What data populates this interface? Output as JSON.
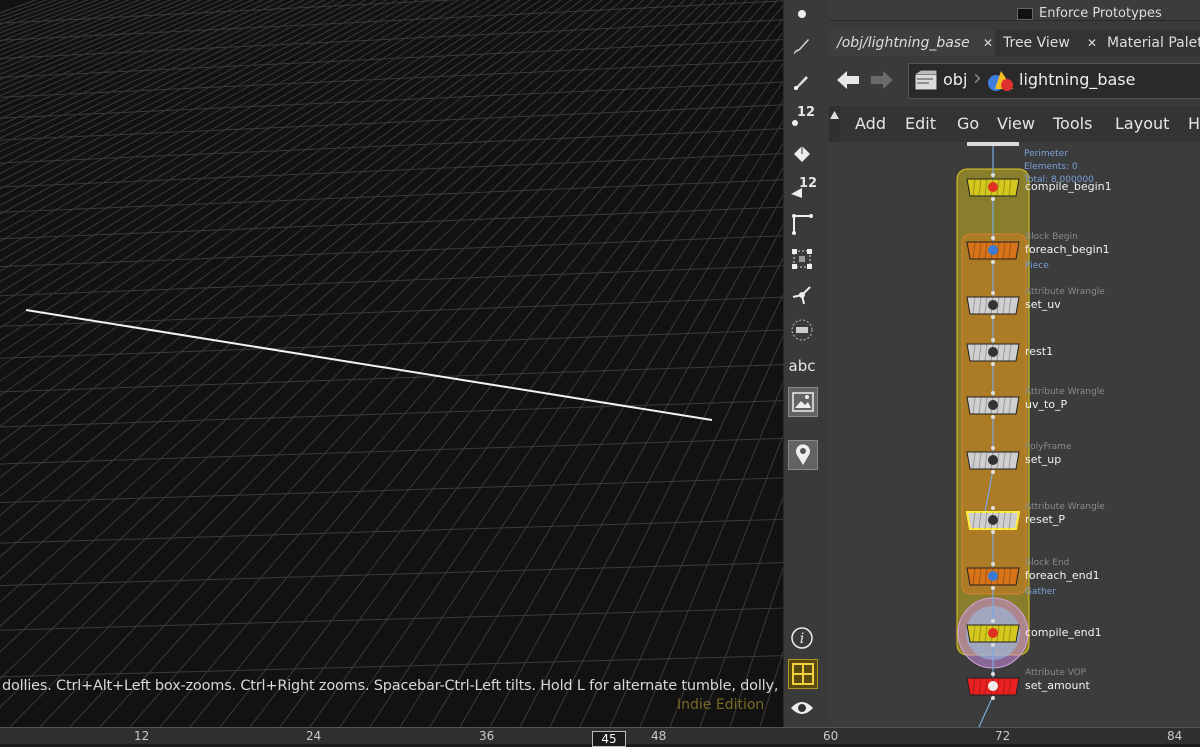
{
  "viewport": {
    "hint_text": "dollies. Ctrl+Alt+Left box-zooms. Ctrl+Right zooms. Spacebar-Ctrl-Left tilts. Hold L for alternate tumble, dolly,",
    "edition_label": "Indie Edition"
  },
  "toolbar": {
    "items": [
      {
        "name": "select-icon"
      },
      {
        "name": "brush-icon"
      },
      {
        "name": "pen-icon"
      },
      {
        "name": "snap-12-icon",
        "label": "12"
      },
      {
        "name": "paint-bucket-icon"
      },
      {
        "name": "display-12-icon",
        "label": "12"
      },
      {
        "name": "angle-icon"
      },
      {
        "name": "bounding-box-icon"
      },
      {
        "name": "transform-handle-icon"
      },
      {
        "name": "ghost-icon"
      },
      {
        "name": "text-abc-icon",
        "label": "abc"
      },
      {
        "name": "background-image-icon"
      },
      {
        "name": "pin-icon"
      },
      {
        "name": "info-icon"
      },
      {
        "name": "grid-view-icon"
      },
      {
        "name": "eye-icon"
      }
    ]
  },
  "timeline": {
    "ticks": [
      "12",
      "24",
      "36",
      "48",
      "60",
      "72",
      "84"
    ],
    "current_frame": "45"
  },
  "panel": {
    "top_checkbox_label": "Enforce Prototypes",
    "tabs": [
      {
        "label": "/obj/lightning_base",
        "closable": true
      },
      {
        "label": "Tree View",
        "closable": true
      },
      {
        "label": "Material Palette",
        "closable": false
      }
    ],
    "path": {
      "root": "obj",
      "current": "lightning_base"
    },
    "menu": [
      "Add",
      "Edit",
      "Go",
      "View",
      "Tools",
      "Layout",
      "H"
    ]
  },
  "network": {
    "perimeter_info": [
      "Perimeter",
      "Elements: 0",
      "Total: 8.000000"
    ],
    "nodes": [
      {
        "name": "compile_begin1",
        "type": "",
        "color": "#d4c81e"
      },
      {
        "name": "foreach_begin1",
        "type": "Block Begin",
        "color": "#d8731a",
        "info": "Piece"
      },
      {
        "name": "set_uv",
        "type": "Attribute Wrangle",
        "color": "#cfcfcf"
      },
      {
        "name": "rest1",
        "type": "",
        "color": "#cfcfcf"
      },
      {
        "name": "uv_to_P",
        "type": "Attribute Wrangle",
        "color": "#cfcfcf"
      },
      {
        "name": "set_up",
        "type": "PolyFrame",
        "color": "#cfcfcf"
      },
      {
        "name": "reset_P",
        "type": "Attribute Wrangle",
        "color": "#cfcfcf"
      },
      {
        "name": "foreach_end1",
        "type": "Block End",
        "color": "#d8731a",
        "info": "Gather"
      },
      {
        "name": "compile_end1",
        "type": "",
        "color": "#d4c81e"
      },
      {
        "name": "set_amount",
        "type": "Attribute VOP",
        "color": "#e82020"
      }
    ]
  }
}
